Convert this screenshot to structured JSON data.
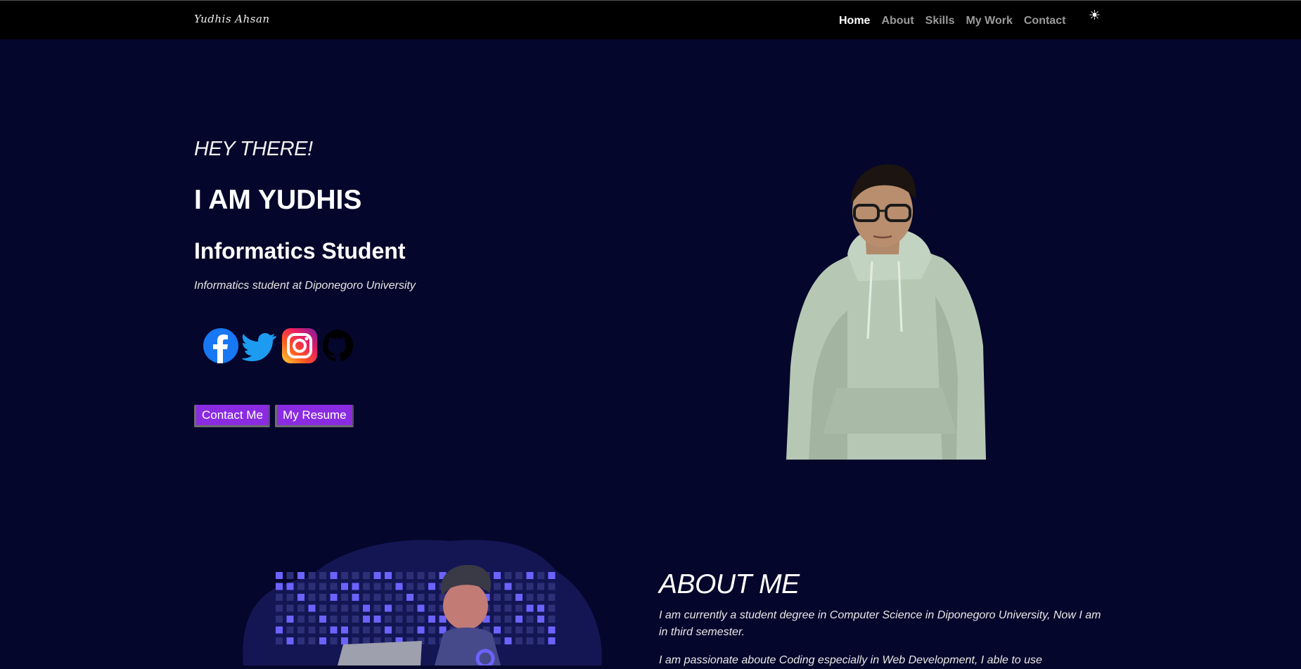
{
  "navbar": {
    "brand": "Yudhis Ahsan",
    "links": [
      {
        "label": "Home",
        "active": true
      },
      {
        "label": "About",
        "active": false
      },
      {
        "label": "Skills",
        "active": false
      },
      {
        "label": "My Work",
        "active": false
      },
      {
        "label": "Contact",
        "active": false
      }
    ],
    "theme_toggle_icon": "☀"
  },
  "hero": {
    "eyebrow": "HEY THERE!",
    "name": "I AM YUDHIS",
    "role": "Informatics Student",
    "description": "Informatics student at Diponegoro University",
    "socials": [
      "facebook-icon",
      "twitter-icon",
      "instagram-icon",
      "github-icon"
    ],
    "buttons": {
      "contact": "Contact Me",
      "resume": "My Resume"
    }
  },
  "about": {
    "title": "ABOUT ME",
    "paragraph_1": "I am currently a student degree in Computer Science in Diponegoro University, Now I am in third semester.",
    "paragraph_2": "I am passionate aboute Coding especially in Web Development, I able to use"
  },
  "colors": {
    "page_background": "#05062b",
    "navbar_background": "#000000",
    "button_background": "#8a2be2",
    "accent_purple": "#6c63ff"
  }
}
